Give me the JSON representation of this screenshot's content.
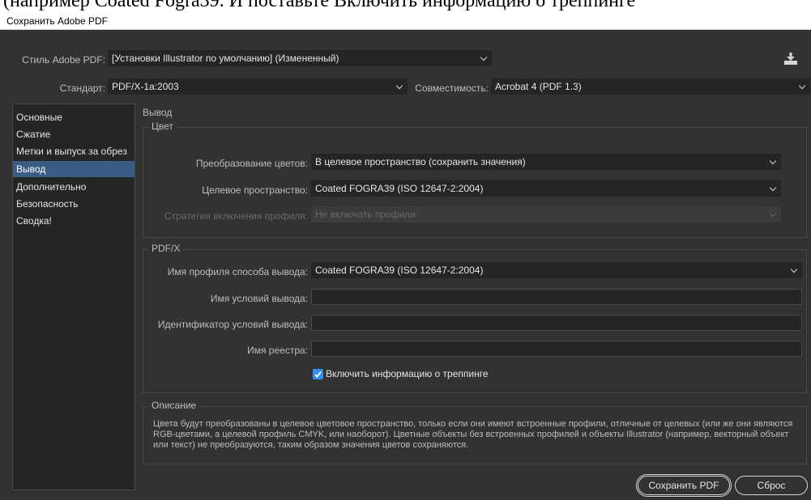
{
  "background_doc": {
    "text": "(например Coated Fogra39. И поставьте Включить информацию о треппинге"
  },
  "window": {
    "title": "Сохранить Adobe PDF"
  },
  "preset": {
    "label": "Стиль Adobe PDF:",
    "value": "[Установки Illustrator по умолчанию] (Измененный)"
  },
  "standard": {
    "label": "Стандарт:",
    "value": "PDF/X-1a:2003"
  },
  "compatibility": {
    "label": "Совместимость:",
    "value": "Acrobat 4 (PDF 1.3)"
  },
  "sidebar": {
    "items": [
      {
        "label": "Основные"
      },
      {
        "label": "Сжатие"
      },
      {
        "label": "Метки и выпуск за обрез"
      },
      {
        "label": "Вывод"
      },
      {
        "label": "Дополнительно"
      },
      {
        "label": "Безопасность"
      },
      {
        "label": "Сводка!"
      }
    ],
    "active_index": 3
  },
  "section": {
    "title": "Вывод"
  },
  "color_group": {
    "title": "Цвет",
    "conversion": {
      "label": "Преобразование цветов:",
      "value": "В целевое пространство (сохранить значения)"
    },
    "destination": {
      "label": "Целевое пространство:",
      "value": "Coated FOGRA39 (ISO 12647-2:2004)"
    },
    "profile_policy": {
      "label": "Стратегия включения профиля:",
      "value": "Не включать профили",
      "enabled": false
    }
  },
  "pdfx_group": {
    "title": "PDF/X",
    "output_intent_profile": {
      "label": "Имя профиля способа вывода:",
      "value": "Coated FOGRA39 (ISO 12647-2:2004)"
    },
    "output_condition_name": {
      "label": "Имя условий вывода:",
      "value": ""
    },
    "output_condition_id": {
      "label": "Идентификатор условий вывода:",
      "value": ""
    },
    "registry_name": {
      "label": "Имя реестра:",
      "value": ""
    },
    "trapping": {
      "label": "Включить информацию о треппинге",
      "checked": true
    }
  },
  "description": {
    "title": "Описание",
    "text": "Цвета будут преобразованы в целевое цветовое пространство, только если они имеют встроенные профили, отличные от целевых (или же они являются RGB-цветами, а целевой профиль CMYK, или наоборот). Цветные объекты без встроенных профилей и объекты Illustrator (например, векторный объект или текст) не преобразуются, таким образом значения цветов сохраняются."
  },
  "buttons": {
    "save": "Сохранить PDF",
    "reset": "Сброс"
  },
  "colors": {
    "dialog_bg": "#323232",
    "field_bg": "#252525",
    "selection": "#3c5d83",
    "checkbox": "#378ef0"
  },
  "icons": {
    "save_preset": "download-icon",
    "dropdown": "chevron-down-icon",
    "check": "checkmark-icon"
  }
}
